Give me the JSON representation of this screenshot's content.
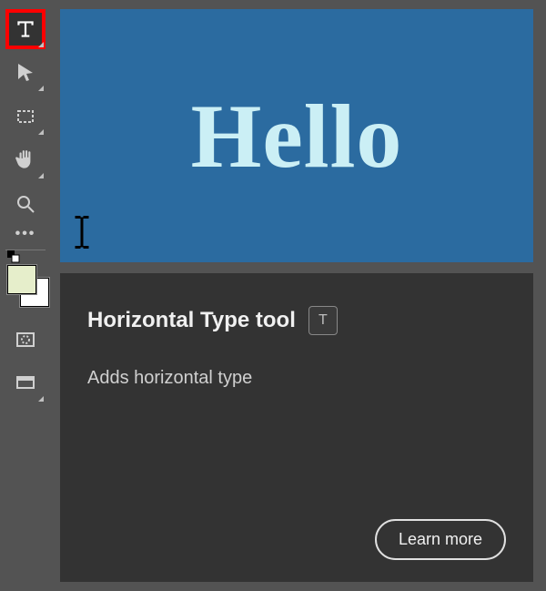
{
  "toolbar": {
    "tools": [
      {
        "id": "type-tool",
        "flyout": true,
        "highlighted": true
      },
      {
        "id": "move-tool",
        "flyout": true
      },
      {
        "id": "marquee-tool",
        "flyout": true
      },
      {
        "id": "hand-tool",
        "flyout": true
      },
      {
        "id": "zoom-tool",
        "flyout": false
      },
      {
        "id": "more-tools",
        "flyout": false
      }
    ],
    "swatches": {
      "fg": "#e6eecb",
      "bg": "#ffffff"
    },
    "quickmask_tool": "quick-mask-tool",
    "screenmode_tool": "screen-mode-tool"
  },
  "preview": {
    "text": "Hello",
    "bg": "#2b6ba0",
    "fg": "#cbeff5"
  },
  "info": {
    "title": "Horizontal Type tool",
    "shortcut": "T",
    "description": "Adds horizontal type",
    "learn_more": "Learn more"
  }
}
